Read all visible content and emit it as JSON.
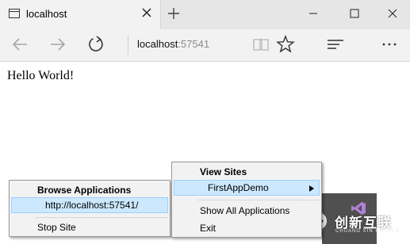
{
  "tab": {
    "title": "localhost"
  },
  "address": {
    "host": "localhost",
    "port": ":57541"
  },
  "page": {
    "content": "Hello World!"
  },
  "menu_left": {
    "header": "Browse Applications",
    "items": [
      {
        "label": "http://localhost:57541/",
        "highlighted": true
      },
      {
        "label": "Stop Site",
        "highlighted": false
      }
    ]
  },
  "menu_right": {
    "header": "View Sites",
    "items": [
      {
        "label": "FirstAppDemo",
        "highlighted": true,
        "submenu": true
      },
      {
        "label": "Show All Applications",
        "highlighted": false
      },
      {
        "label": "Exit",
        "highlighted": false
      }
    ]
  },
  "watermark": {
    "text": "创新互联",
    "sub": "CHUANG XIN HU LIAN"
  },
  "colors": {
    "highlight": "#cce8ff",
    "tray": "#505050",
    "vs_purple": "#68217a"
  },
  "icons": [
    "page-icon",
    "close-icon",
    "plus-icon",
    "minimize-icon",
    "maximize-icon",
    "back-arrow-icon",
    "forward-arrow-icon",
    "refresh-icon",
    "reading-view-icon",
    "star-icon",
    "hub-icon",
    "more-icon",
    "submenu-arrow-icon",
    "visual-studio-icon",
    "watermark-logo-icon"
  ]
}
